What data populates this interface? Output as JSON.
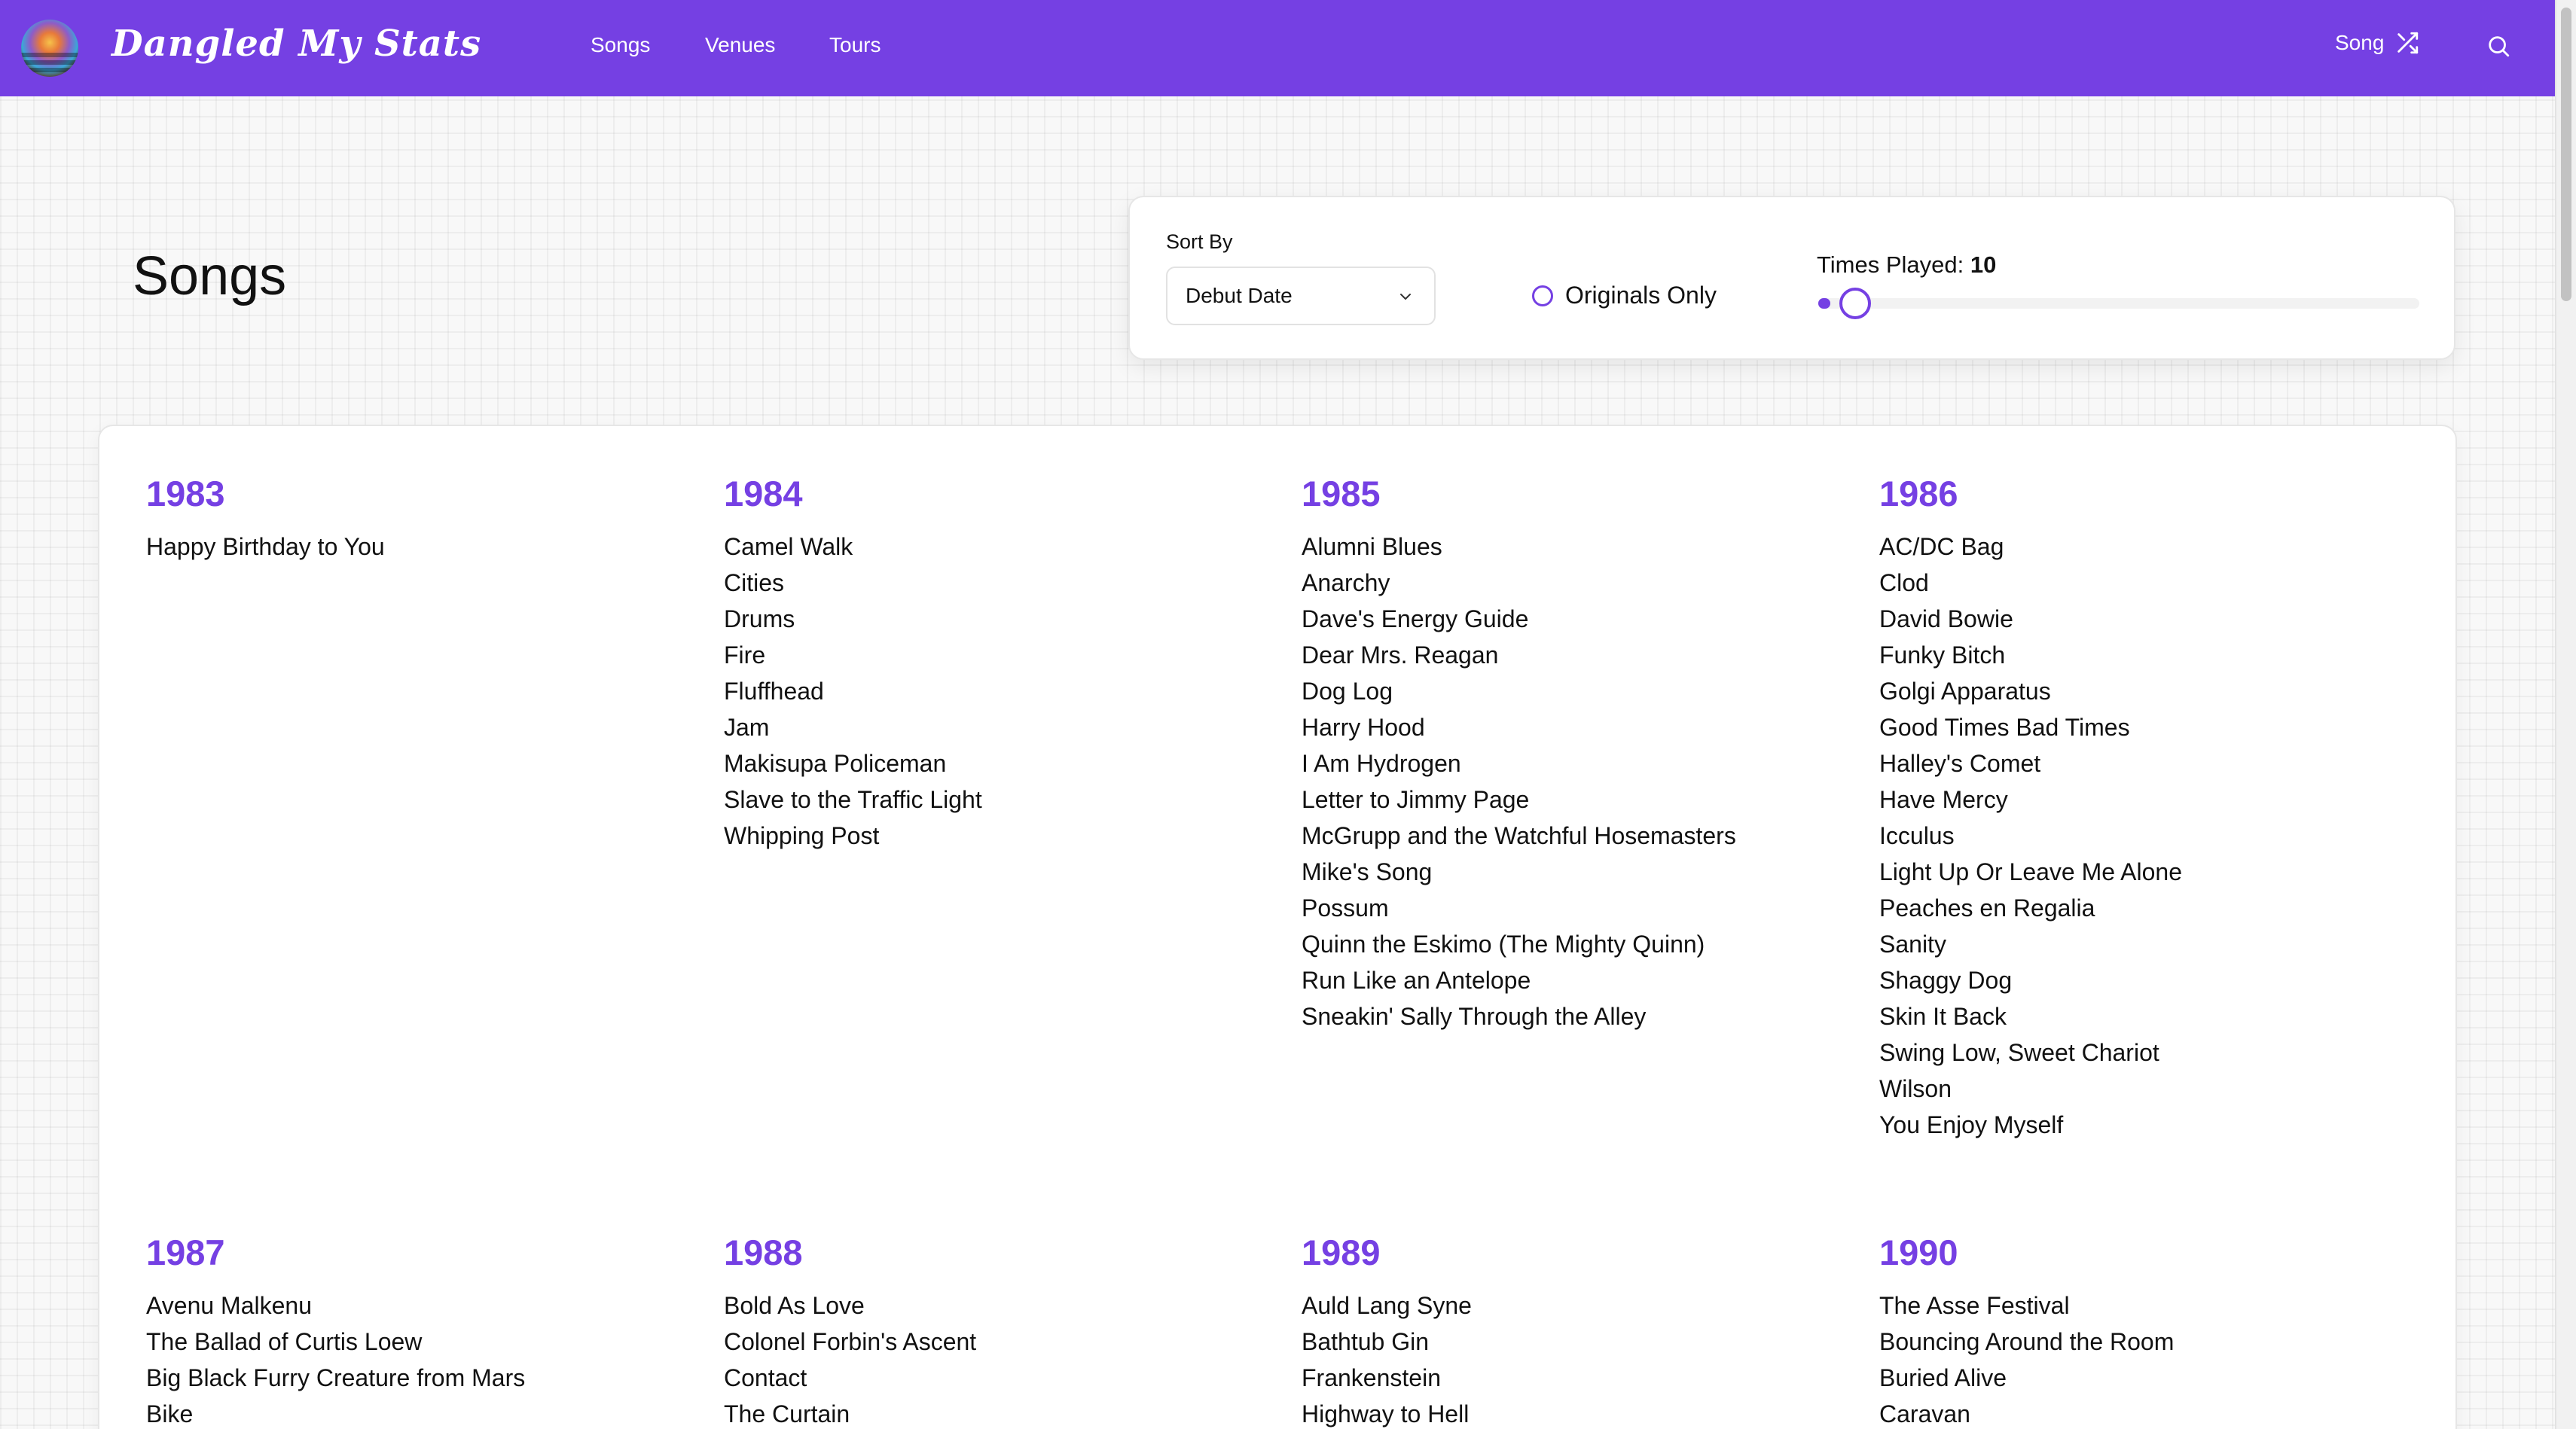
{
  "header": {
    "brand": "Dangled My Stats",
    "nav": [
      "Songs",
      "Venues",
      "Tours"
    ],
    "random_song_label": "Song",
    "accent_color": "#7540e3"
  },
  "page": {
    "title": "Songs"
  },
  "filters": {
    "sort_by_label": "Sort By",
    "sort_by_value": "Debut Date",
    "originals_only_label": "Originals Only",
    "originals_only_checked": false,
    "times_played_label": "Times Played:",
    "times_played_value": "10",
    "times_played_fraction": 0.02
  },
  "years": [
    {
      "year": "1983",
      "songs": [
        "Happy Birthday to You"
      ]
    },
    {
      "year": "1984",
      "songs": [
        "Camel Walk",
        "Cities",
        "Drums",
        "Fire",
        "Fluffhead",
        "Jam",
        "Makisupa Policeman",
        "Slave to the Traffic Light",
        "Whipping Post"
      ]
    },
    {
      "year": "1985",
      "songs": [
        "Alumni Blues",
        "Anarchy",
        "Dave's Energy Guide",
        "Dear Mrs. Reagan",
        "Dog Log",
        "Harry Hood",
        "I Am Hydrogen",
        "Letter to Jimmy Page",
        "McGrupp and the Watchful Hosemasters",
        "Mike's Song",
        "Possum",
        "Quinn the Eskimo (The Mighty Quinn)",
        "Run Like an Antelope",
        "Sneakin' Sally Through the Alley"
      ]
    },
    {
      "year": "1986",
      "songs": [
        "AC/DC Bag",
        "Clod",
        "David Bowie",
        "Funky Bitch",
        "Golgi Apparatus",
        "Good Times Bad Times",
        "Halley's Comet",
        "Have Mercy",
        "Icculus",
        "Light Up Or Leave Me Alone",
        "Peaches en Regalia",
        "Sanity",
        "Shaggy Dog",
        "Skin It Back",
        "Swing Low, Sweet Chariot",
        "Wilson",
        "You Enjoy Myself"
      ]
    },
    {
      "year": "1987",
      "songs": [
        "Avenu Malkenu",
        "The Ballad of Curtis Loew",
        "Big Black Furry Creature from Mars",
        "Bike"
      ]
    },
    {
      "year": "1988",
      "songs": [
        "Bold As Love",
        "Colonel Forbin's Ascent",
        "Contact",
        "The Curtain"
      ]
    },
    {
      "year": "1989",
      "songs": [
        "Auld Lang Syne",
        "Bathtub Gin",
        "Frankenstein",
        "Highway to Hell"
      ]
    },
    {
      "year": "1990",
      "songs": [
        "The Asse Festival",
        "Bouncing Around the Room",
        "Buried Alive",
        "Caravan"
      ]
    }
  ]
}
